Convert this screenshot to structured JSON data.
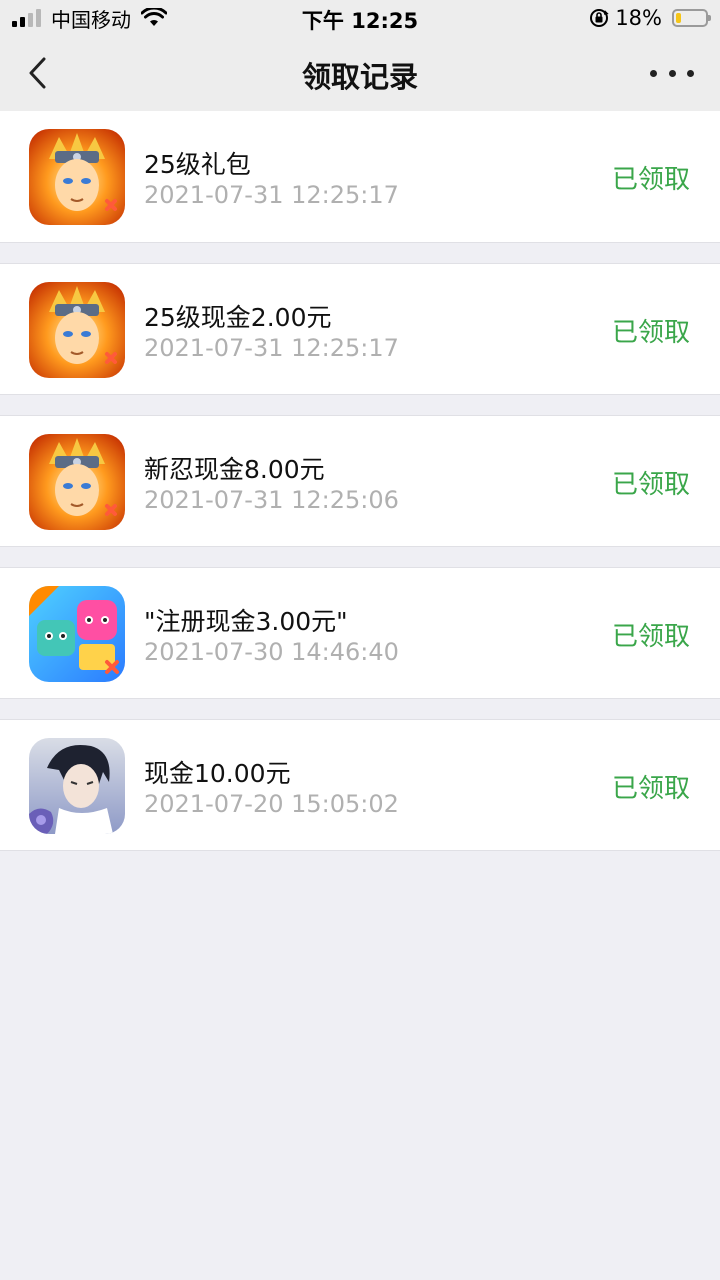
{
  "status_bar": {
    "carrier": "中国移动",
    "time": "下午 12:25",
    "battery_percent": "18%",
    "battery_level": 0.18,
    "icons": [
      "signal-icon",
      "wifi-icon",
      "orientation-lock-icon",
      "battery-icon"
    ]
  },
  "nav": {
    "title": "领取记录",
    "back_icon": "chevron-left-icon",
    "more_icon": "more-dots-icon"
  },
  "records": [
    {
      "title": "25级礼包",
      "time": "2021-07-31 12:25:17",
      "status": "已领取",
      "icon": "naruto-app-icon"
    },
    {
      "title": "25级现金2.00元",
      "time": "2021-07-31 12:25:17",
      "status": "已领取",
      "icon": "naruto-app-icon"
    },
    {
      "title": "新忍现金8.00元",
      "time": "2021-07-31 12:25:06",
      "status": "已领取",
      "icon": "naruto-app-icon"
    },
    {
      "title": "\"注册现金3.00元\"",
      "time": "2021-07-30 14:46:40",
      "status": "已领取",
      "icon": "cartoon-game-app-icon"
    },
    {
      "title": "现金10.00元",
      "time": "2021-07-20 15:05:02",
      "status": "已领取",
      "icon": "romance-game-app-icon"
    }
  ],
  "colors": {
    "status_green": "#3aa64a",
    "background": "#efeff4",
    "nav_background": "#ededed",
    "time_gray": "#b0b0b0"
  }
}
